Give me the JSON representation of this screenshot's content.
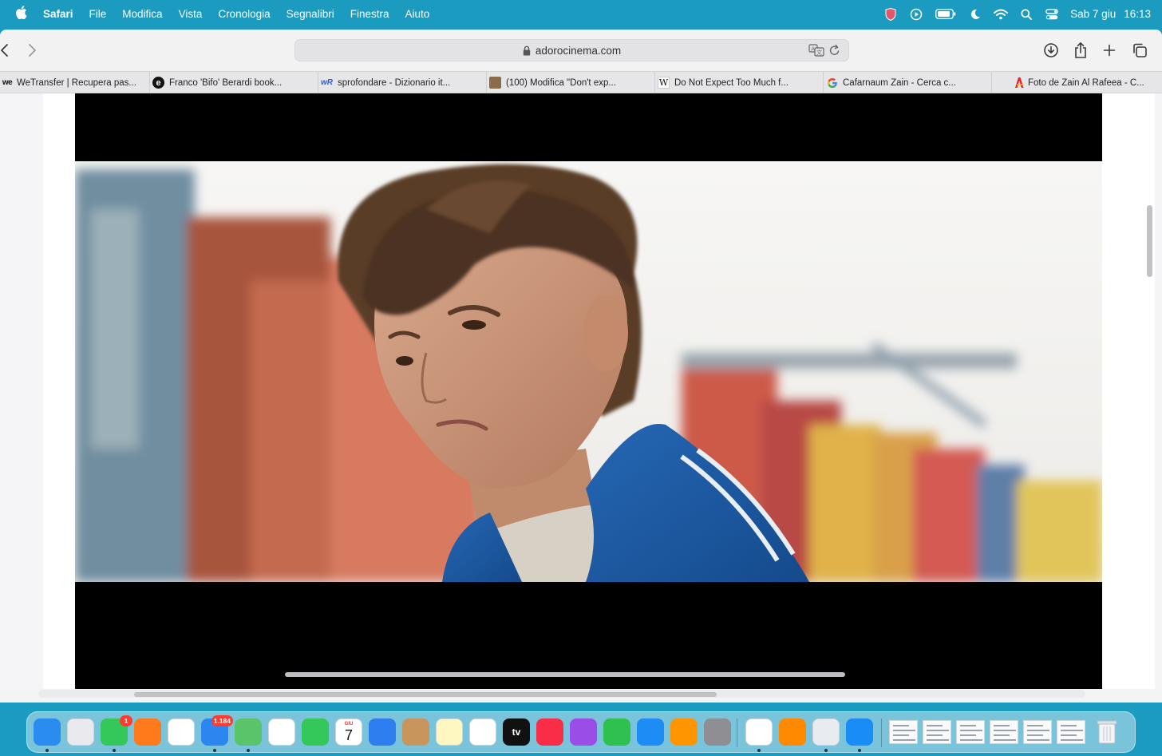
{
  "menubar": {
    "app_name": "Safari",
    "items": [
      "File",
      "Modifica",
      "Vista",
      "Cronologia",
      "Segnalibri",
      "Finestra",
      "Aiuto"
    ],
    "status_icons": [
      "shield-icon",
      "play-circle-icon",
      "battery-icon",
      "moon-icon",
      "wifi-icon",
      "search-icon",
      "control-center-icon"
    ],
    "date": "Sab 7 giu",
    "time": "16:13"
  },
  "toolbar": {
    "url": "adorocinema.com"
  },
  "tabs": [
    {
      "title": "WeTransfer | Recupera pas...",
      "favicon": "we"
    },
    {
      "title": "Franco 'Bifo' Berardi book...",
      "favicon": "e"
    },
    {
      "title": "sprofondare - Dizionario it...",
      "favicon": "wR"
    },
    {
      "title": "(100) Modifica \"Don't exp...",
      "favicon": "img"
    },
    {
      "title": "Do Not Expect Too Much f...",
      "favicon": "W"
    },
    {
      "title": "Cafarnaum Zain - Cerca c...",
      "favicon": "G"
    },
    {
      "title": "Foto de Zain Al Rafeea - C...",
      "favicon": "A"
    }
  ],
  "dock": {
    "apps": [
      {
        "name": "finder-icon",
        "color": "#2b8cf0"
      },
      {
        "name": "launchpad-icon",
        "color": "#e9e9ee"
      },
      {
        "name": "messages-icon",
        "color": "#34c759",
        "badge": "1"
      },
      {
        "name": "firefox-icon",
        "color": "#ff7a1a"
      },
      {
        "name": "reminders-icon",
        "color": "#ffffff"
      },
      {
        "name": "mail-icon",
        "color": "#2d86f0",
        "badge": "1.184"
      },
      {
        "name": "maps-icon",
        "color": "#5ac46a"
      },
      {
        "name": "photos-icon",
        "color": "#ffffff"
      },
      {
        "name": "facetime-icon",
        "color": "#34c759"
      },
      {
        "name": "calendar-icon",
        "color": "#ffffff",
        "label_month": "GIU",
        "label_day": "7"
      },
      {
        "name": "keynote-icon",
        "color": "#2f7ef0"
      },
      {
        "name": "contacts-icon",
        "color": "#c8955d"
      },
      {
        "name": "notes-icon",
        "color": "#fff7c2"
      },
      {
        "name": "freeform-icon",
        "color": "#ffffff"
      },
      {
        "name": "apple-tv-icon",
        "color": "#111111",
        "label": "tv"
      },
      {
        "name": "music-icon",
        "color": "#fa2d48"
      },
      {
        "name": "podcasts-icon",
        "color": "#9b4de8"
      },
      {
        "name": "numbers-icon",
        "color": "#30c04f"
      },
      {
        "name": "app-store-icon",
        "color": "#1d8cf5"
      },
      {
        "name": "pages-icon",
        "color": "#ff9500"
      },
      {
        "name": "system-settings-icon",
        "color": "#8e8e93"
      },
      {
        "name": "color-picker-icon",
        "color": "#ffffff"
      },
      {
        "name": "books-icon",
        "color": "#ff8a00"
      },
      {
        "name": "preview-icon",
        "color": "#e8ecf0"
      },
      {
        "name": "safari-icon",
        "color": "#1a8cf5"
      }
    ],
    "trash": "trash-icon"
  }
}
